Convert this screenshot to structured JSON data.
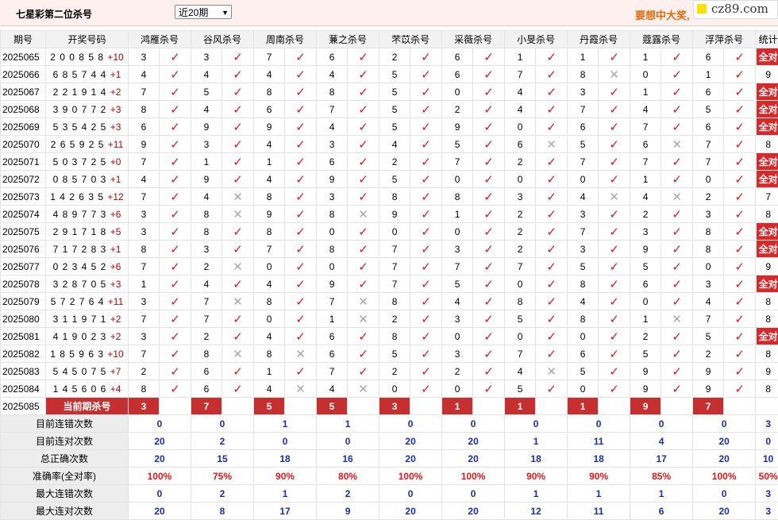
{
  "header": {
    "title": "七星彩第二位杀号",
    "period_select": "近20期",
    "promo": "要想中大奖,",
    "logo": "cz89.com"
  },
  "columns": [
    "期号",
    "开奖号码",
    "鸿雁杀号",
    "谷风杀号",
    "周南杀号",
    "蒹之杀号",
    "芣苡杀号",
    "采薇杀号",
    "小旻杀号",
    "丹霞杀号",
    "蔻露杀号",
    "浮萍杀号",
    "统计"
  ],
  "rows": [
    {
      "issue": "2025065",
      "digits": "200858",
      "plus": "+10",
      "kills": [
        [
          "3",
          1
        ],
        [
          "3",
          1
        ],
        [
          "7",
          1
        ],
        [
          "6",
          1
        ],
        [
          "2",
          1
        ],
        [
          "6",
          1
        ],
        [
          "1",
          1
        ],
        [
          "1",
          1
        ],
        [
          "1",
          1
        ],
        [
          "6",
          1
        ]
      ],
      "stat": "全对"
    },
    {
      "issue": "2025066",
      "digits": "685744",
      "plus": "+1",
      "kills": [
        [
          "4",
          1
        ],
        [
          "4",
          1
        ],
        [
          "4",
          1
        ],
        [
          "4",
          1
        ],
        [
          "5",
          1
        ],
        [
          "6",
          1
        ],
        [
          "7",
          1
        ],
        [
          "8",
          0
        ],
        [
          "0",
          1
        ],
        [
          "1",
          1
        ]
      ],
      "stat": "9"
    },
    {
      "issue": "2025067",
      "digits": "221914",
      "plus": "+2",
      "kills": [
        [
          "7",
          1
        ],
        [
          "5",
          1
        ],
        [
          "8",
          1
        ],
        [
          "8",
          1
        ],
        [
          "5",
          1
        ],
        [
          "0",
          1
        ],
        [
          "4",
          1
        ],
        [
          "3",
          1
        ],
        [
          "1",
          1
        ],
        [
          "6",
          1
        ]
      ],
      "stat": "全对"
    },
    {
      "issue": "2025068",
      "digits": "390772",
      "plus": "+3",
      "kills": [
        [
          "8",
          1
        ],
        [
          "4",
          1
        ],
        [
          "6",
          1
        ],
        [
          "7",
          1
        ],
        [
          "5",
          1
        ],
        [
          "2",
          1
        ],
        [
          "4",
          1
        ],
        [
          "7",
          1
        ],
        [
          "4",
          1
        ],
        [
          "5",
          1
        ]
      ],
      "stat": "全对"
    },
    {
      "issue": "2025069",
      "digits": "535425",
      "plus": "+3",
      "kills": [
        [
          "6",
          1
        ],
        [
          "9",
          1
        ],
        [
          "9",
          1
        ],
        [
          "4",
          1
        ],
        [
          "5",
          1
        ],
        [
          "9",
          1
        ],
        [
          "0",
          1
        ],
        [
          "6",
          1
        ],
        [
          "7",
          1
        ],
        [
          "6",
          1
        ]
      ],
      "stat": "全对"
    },
    {
      "issue": "2025070",
      "digits": "265925",
      "plus": "+11",
      "kills": [
        [
          "9",
          1
        ],
        [
          "3",
          1
        ],
        [
          "4",
          1
        ],
        [
          "3",
          1
        ],
        [
          "4",
          1
        ],
        [
          "5",
          1
        ],
        [
          "6",
          0
        ],
        [
          "5",
          1
        ],
        [
          "6",
          0
        ],
        [
          "7",
          1
        ]
      ],
      "stat": "8"
    },
    {
      "issue": "2025071",
      "digits": "503725",
      "plus": "+0",
      "kills": [
        [
          "7",
          1
        ],
        [
          "1",
          1
        ],
        [
          "1",
          1
        ],
        [
          "6",
          1
        ],
        [
          "2",
          1
        ],
        [
          "7",
          1
        ],
        [
          "2",
          1
        ],
        [
          "7",
          1
        ],
        [
          "7",
          1
        ],
        [
          "7",
          1
        ]
      ],
      "stat": "全对"
    },
    {
      "issue": "2025072",
      "digits": "085703",
      "plus": "+1",
      "kills": [
        [
          "4",
          1
        ],
        [
          "9",
          1
        ],
        [
          "4",
          1
        ],
        [
          "9",
          1
        ],
        [
          "5",
          1
        ],
        [
          "0",
          1
        ],
        [
          "0",
          1
        ],
        [
          "0",
          1
        ],
        [
          "1",
          1
        ],
        [
          "0",
          1
        ]
      ],
      "stat": "全对"
    },
    {
      "issue": "2025073",
      "digits": "142635",
      "plus": "+12",
      "kills": [
        [
          "7",
          1
        ],
        [
          "4",
          0
        ],
        [
          "8",
          1
        ],
        [
          "3",
          1
        ],
        [
          "8",
          1
        ],
        [
          "8",
          1
        ],
        [
          "3",
          1
        ],
        [
          "4",
          0
        ],
        [
          "4",
          0
        ],
        [
          "2",
          1
        ]
      ],
      "stat": "7"
    },
    {
      "issue": "2025074",
      "digits": "489773",
      "plus": "+6",
      "kills": [
        [
          "3",
          1
        ],
        [
          "8",
          0
        ],
        [
          "9",
          1
        ],
        [
          "8",
          0
        ],
        [
          "9",
          1
        ],
        [
          "1",
          1
        ],
        [
          "2",
          1
        ],
        [
          "3",
          1
        ],
        [
          "2",
          1
        ],
        [
          "3",
          1
        ]
      ],
      "stat": "8"
    },
    {
      "issue": "2025075",
      "digits": "291718",
      "plus": "+5",
      "kills": [
        [
          "3",
          1
        ],
        [
          "8",
          1
        ],
        [
          "8",
          1
        ],
        [
          "0",
          1
        ],
        [
          "0",
          1
        ],
        [
          "0",
          1
        ],
        [
          "2",
          1
        ],
        [
          "7",
          1
        ],
        [
          "3",
          1
        ],
        [
          "8",
          1
        ]
      ],
      "stat": "全对"
    },
    {
      "issue": "2025076",
      "digits": "717283",
      "plus": "+1",
      "kills": [
        [
          "8",
          1
        ],
        [
          "3",
          1
        ],
        [
          "7",
          1
        ],
        [
          "8",
          1
        ],
        [
          "7",
          1
        ],
        [
          "3",
          1
        ],
        [
          "2",
          1
        ],
        [
          "3",
          1
        ],
        [
          "9",
          1
        ],
        [
          "8",
          1
        ]
      ],
      "stat": "全对"
    },
    {
      "issue": "2025077",
      "digits": "023452",
      "plus": "+6",
      "kills": [
        [
          "7",
          1
        ],
        [
          "2",
          0
        ],
        [
          "0",
          1
        ],
        [
          "0",
          1
        ],
        [
          "7",
          1
        ],
        [
          "7",
          1
        ],
        [
          "7",
          1
        ],
        [
          "5",
          1
        ],
        [
          "5",
          1
        ],
        [
          "0",
          1
        ]
      ],
      "stat": "9"
    },
    {
      "issue": "2025078",
      "digits": "328705",
      "plus": "+3",
      "kills": [
        [
          "1",
          1
        ],
        [
          "4",
          1
        ],
        [
          "4",
          1
        ],
        [
          "9",
          1
        ],
        [
          "7",
          1
        ],
        [
          "5",
          1
        ],
        [
          "0",
          1
        ],
        [
          "8",
          1
        ],
        [
          "6",
          1
        ],
        [
          "3",
          1
        ]
      ],
      "stat": "全对"
    },
    {
      "issue": "2025079",
      "digits": "572764",
      "plus": "+11",
      "kills": [
        [
          "3",
          1
        ],
        [
          "7",
          0
        ],
        [
          "8",
          1
        ],
        [
          "7",
          0
        ],
        [
          "8",
          1
        ],
        [
          "4",
          1
        ],
        [
          "8",
          1
        ],
        [
          "4",
          1
        ],
        [
          "0",
          1
        ],
        [
          "4",
          1
        ]
      ],
      "stat": "8"
    },
    {
      "issue": "2025080",
      "digits": "311971",
      "plus": "+2",
      "kills": [
        [
          "7",
          1
        ],
        [
          "7",
          1
        ],
        [
          "0",
          1
        ],
        [
          "1",
          0
        ],
        [
          "2",
          1
        ],
        [
          "3",
          1
        ],
        [
          "5",
          1
        ],
        [
          "8",
          1
        ],
        [
          "1",
          0
        ],
        [
          "7",
          1
        ]
      ],
      "stat": "8"
    },
    {
      "issue": "2025081",
      "digits": "419023",
      "plus": "+2",
      "kills": [
        [
          "3",
          1
        ],
        [
          "2",
          1
        ],
        [
          "4",
          1
        ],
        [
          "6",
          1
        ],
        [
          "8",
          1
        ],
        [
          "0",
          1
        ],
        [
          "0",
          1
        ],
        [
          "0",
          1
        ],
        [
          "2",
          1
        ],
        [
          "5",
          1
        ]
      ],
      "stat": "全对"
    },
    {
      "issue": "2025082",
      "digits": "185963",
      "plus": "+10",
      "kills": [
        [
          "7",
          1
        ],
        [
          "8",
          0
        ],
        [
          "8",
          0
        ],
        [
          "6",
          1
        ],
        [
          "5",
          1
        ],
        [
          "3",
          1
        ],
        [
          "7",
          1
        ],
        [
          "6",
          1
        ],
        [
          "5",
          1
        ],
        [
          "2",
          1
        ]
      ],
      "stat": "8"
    },
    {
      "issue": "2025083",
      "digits": "545075",
      "plus": "+7",
      "kills": [
        [
          "2",
          1
        ],
        [
          "6",
          1
        ],
        [
          "1",
          1
        ],
        [
          "7",
          1
        ],
        [
          "2",
          1
        ],
        [
          "2",
          1
        ],
        [
          "4",
          0
        ],
        [
          "5",
          1
        ],
        [
          "9",
          1
        ],
        [
          "9",
          1
        ]
      ],
      "stat": "9"
    },
    {
      "issue": "2025084",
      "digits": "145606",
      "plus": "+4",
      "kills": [
        [
          "8",
          1
        ],
        [
          "6",
          1
        ],
        [
          "4",
          0
        ],
        [
          "4",
          0
        ],
        [
          "0",
          1
        ],
        [
          "0",
          1
        ],
        [
          "5",
          1
        ],
        [
          "0",
          1
        ],
        [
          "9",
          1
        ],
        [
          "9",
          1
        ]
      ],
      "stat": "8"
    }
  ],
  "prediction": {
    "issue": "2025085",
    "label": "当前期杀号",
    "values": [
      "3",
      "7",
      "5",
      "5",
      "3",
      "1",
      "1",
      "1",
      "9",
      "7"
    ]
  },
  "marks": {
    "ok": "✓",
    "bad": "✕"
  },
  "summary": [
    {
      "label": "目前连错次数",
      "values": [
        "0",
        "0",
        "1",
        "1",
        "0",
        "0",
        "0",
        "0",
        "0",
        "0"
      ],
      "last": "3"
    },
    {
      "label": "目前连对次数",
      "values": [
        "20",
        "2",
        "0",
        "0",
        "20",
        "20",
        "1",
        "11",
        "4",
        "20"
      ],
      "last": "0"
    },
    {
      "label": "总正确次数",
      "values": [
        "20",
        "15",
        "18",
        "16",
        "20",
        "20",
        "18",
        "18",
        "17",
        "20"
      ],
      "last": "10"
    },
    {
      "label": "准确率(全对率)",
      "values": [
        "100%",
        "75%",
        "90%",
        "80%",
        "100%",
        "100%",
        "90%",
        "90%",
        "85%",
        "100%"
      ],
      "last": "50%",
      "rate": true
    },
    {
      "label": "最大连错次数",
      "values": [
        "0",
        "2",
        "1",
        "2",
        "0",
        "0",
        "1",
        "1",
        "1",
        "0"
      ],
      "last": "3"
    },
    {
      "label": "最大连对次数",
      "values": [
        "20",
        "8",
        "17",
        "9",
        "20",
        "20",
        "12",
        "11",
        "6",
        "20"
      ],
      "last": "3"
    }
  ],
  "colors": {
    "accent_red": "#D9272A",
    "header_bg": "#FFF0F0",
    "summary_blue": "#1A2FA8",
    "promo_orange": "#E36C09"
  }
}
